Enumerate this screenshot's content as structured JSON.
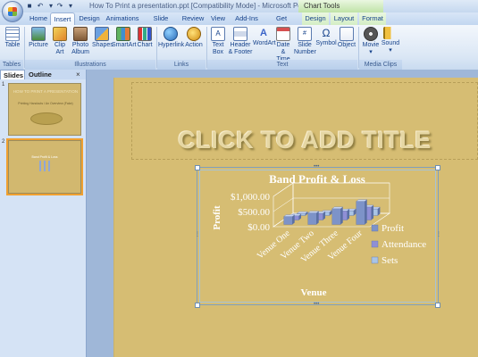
{
  "window": {
    "title": "How To Print a presentation.ppt [Compatibility Mode] - Microsoft PowerPoint",
    "contextual_group": "Chart Tools"
  },
  "tabs": [
    "Home",
    "Insert",
    "Design",
    "Animations",
    "Slide Show",
    "Review",
    "View",
    "Add-Ins",
    "Get Started",
    "Design",
    "Layout",
    "Format"
  ],
  "active_tab": "Insert",
  "ribbon": {
    "groups": [
      {
        "label": "Tables",
        "buttons": [
          "Table"
        ]
      },
      {
        "label": "Illustrations",
        "buttons": [
          "Picture",
          "Clip Art",
          "Photo Album",
          "Shapes",
          "SmartArt",
          "Chart"
        ]
      },
      {
        "label": "Links",
        "buttons": [
          "Hyperlink",
          "Action"
        ]
      },
      {
        "label": "Text",
        "buttons": [
          "Text Box",
          "Header & Footer",
          "WordArt",
          "Date & Time",
          "Slide Number",
          "Symbol",
          "Object"
        ]
      },
      {
        "label": "Media Clips",
        "buttons": [
          "Movie",
          "Sound"
        ]
      }
    ]
  },
  "pane": {
    "tabs": [
      "Slides",
      "Outline"
    ],
    "close": "×",
    "thumbnails": [
      {
        "number": "1",
        "title": "HOW TO PRINT A PRESENTATION",
        "subtitle": "Printing Handouts / An Overview (Fake)"
      },
      {
        "number": "2",
        "title": "Band Profit & Loss"
      }
    ]
  },
  "slide": {
    "title_placeholder": "CLICK TO ADD TITLE"
  },
  "chart_data": {
    "type": "bar",
    "title": "Band Profit & Loss",
    "xlabel": "Venue",
    "ylabel": "Profit",
    "categories": [
      "Venue One",
      "Venue Two",
      "Venue Three",
      "Venue Four"
    ],
    "y_ticks": [
      "$1,000.00",
      "$500.00",
      "$0.00"
    ],
    "ylim": [
      0,
      1000
    ],
    "series": [
      {
        "name": "Profit",
        "values": [
          260,
          380,
          520,
          760
        ],
        "color": "#7d93c8"
      },
      {
        "name": "Attendance",
        "values": [
          140,
          220,
          300,
          430
        ],
        "color": "#8f8fd6"
      },
      {
        "name": "Sets",
        "values": [
          70,
          110,
          160,
          220
        ],
        "color": "#a9c4e6"
      }
    ],
    "legend_position": "right",
    "three_d": true
  }
}
